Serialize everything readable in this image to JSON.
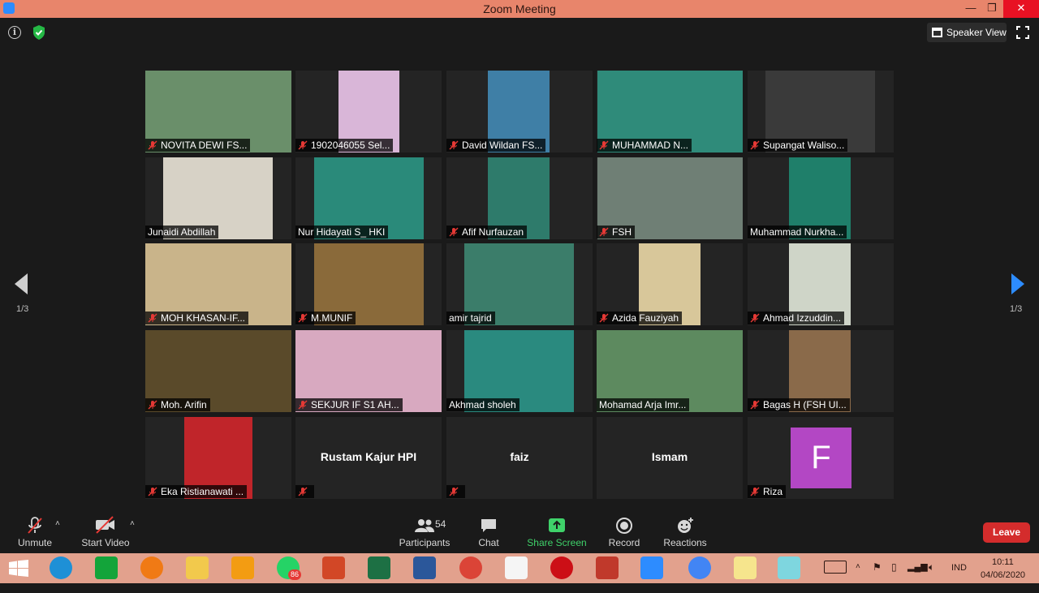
{
  "window": {
    "title": "Zoom Meeting",
    "minimize": "—",
    "maximize": "❐",
    "close": "✕"
  },
  "top_bar": {
    "view_mode": "Speaker View"
  },
  "pager": {
    "left_indicator": "1/3",
    "right_indicator": "1/3"
  },
  "participants": [
    {
      "name": "NOVITA DEWI FS...",
      "muted": true
    },
    {
      "name": "1902046055 Sel...",
      "muted": true
    },
    {
      "name": "David Wildan FS...",
      "muted": true
    },
    {
      "name": "MUHAMMAD N...",
      "muted": true
    },
    {
      "name": "Supangat Waliso...",
      "muted": true
    },
    {
      "name": "Junaidi Abdillah",
      "muted": false
    },
    {
      "name": "Nur Hidayati S_ HKI",
      "muted": false
    },
    {
      "name": "Afif Nurfauzan",
      "muted": true
    },
    {
      "name": "FSH",
      "muted": true
    },
    {
      "name": "Muhammad Nurkha...",
      "muted": false
    },
    {
      "name": "MOH KHASAN-IF...",
      "muted": true
    },
    {
      "name": "M.MUNIF",
      "muted": true
    },
    {
      "name": "amir tajrid",
      "muted": false
    },
    {
      "name": "Azida Fauziyah",
      "muted": true
    },
    {
      "name": "Ahmad Izzuddin...",
      "muted": true
    },
    {
      "name": "Moh. Arifin",
      "muted": true
    },
    {
      "name": "SEKJUR IF S1 AH...",
      "muted": true
    },
    {
      "name": "Akhmad sholeh",
      "muted": false
    },
    {
      "name": "Mohamad Arja Imr...",
      "muted": false,
      "active_speaker": true
    },
    {
      "name": "Bagas H (FSH UI...",
      "muted": true
    },
    {
      "name": "Eka Ristianawati ...",
      "muted": true
    },
    {
      "name": "Rustam Kajur HPI",
      "muted": true,
      "video_off": true
    },
    {
      "name": "faiz",
      "muted": true,
      "video_off": true
    },
    {
      "name": "Ismam",
      "muted": false,
      "video_off": true
    },
    {
      "name": "Riza",
      "muted": true,
      "video_off": true,
      "avatar_letter": "F"
    }
  ],
  "toolbar": {
    "unmute": "Unmute",
    "start_video": "Start Video",
    "participants_count": "54",
    "participants": "Participants",
    "chat": "Chat",
    "share_screen": "Share Screen",
    "record": "Record",
    "reactions": "Reactions",
    "leave": "Leave"
  },
  "taskbar": {
    "whatsapp_badge": "86",
    "language": "IND",
    "time": "10:11",
    "date": "04/06/2020"
  },
  "colors": {
    "titlebar": "#e8856b",
    "accent_blue": "#2d8cff",
    "share_green": "#3fd26a",
    "leave_red": "#d42c2c",
    "active_speaker": "#e3e35a",
    "avatar_purple": "#b347c4"
  }
}
